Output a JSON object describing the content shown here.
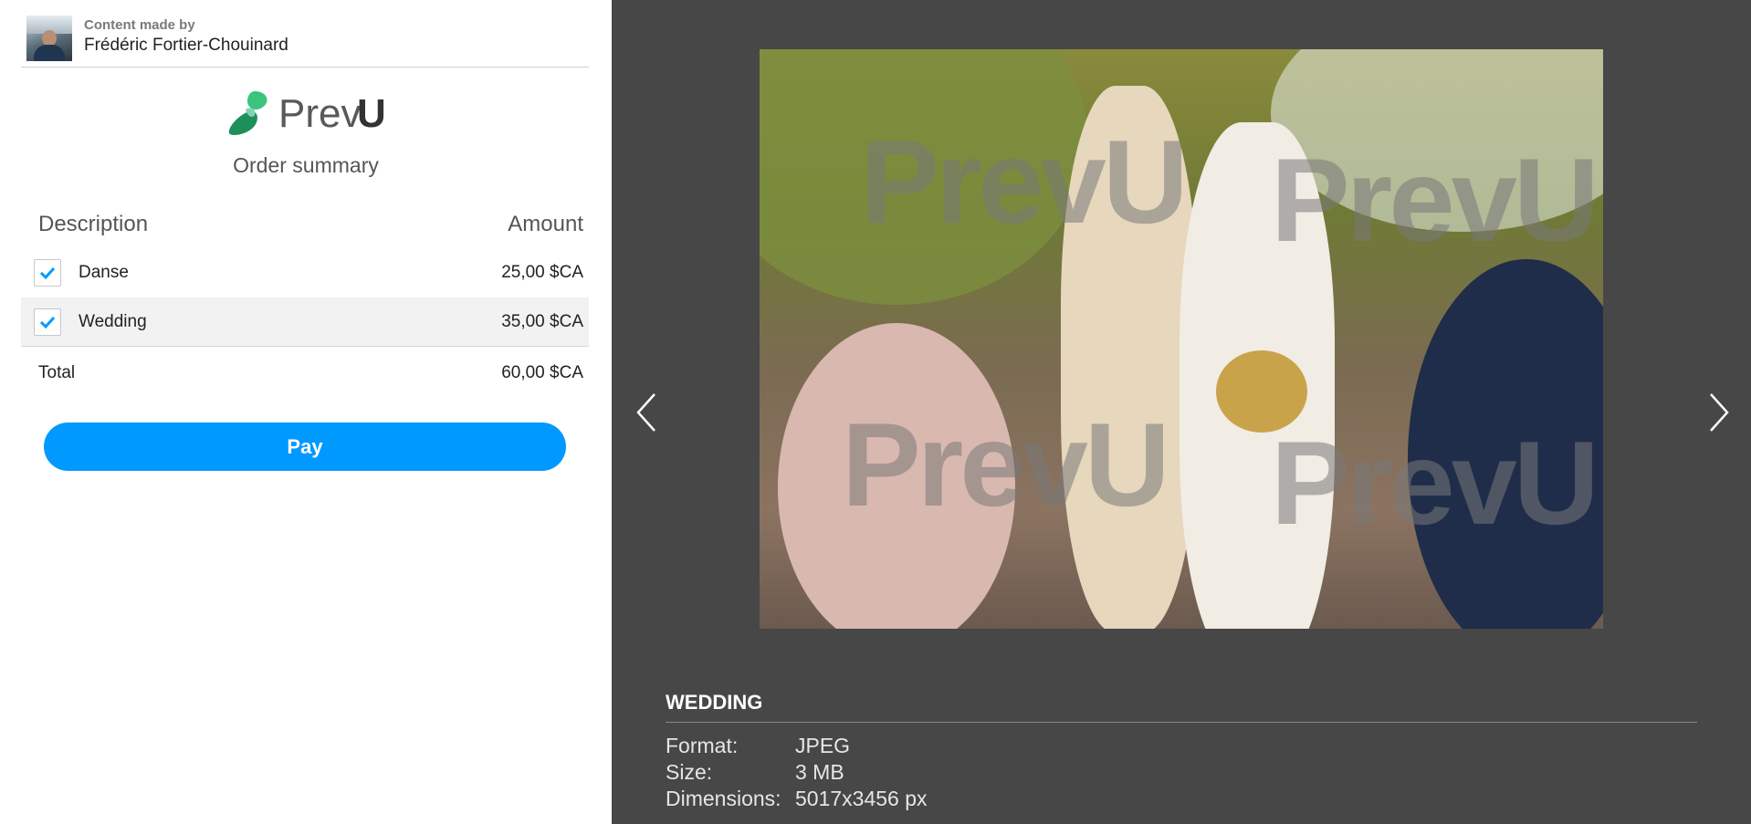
{
  "creator": {
    "made_by_label": "Content made by",
    "name": "Frédéric Fortier-Chouinard"
  },
  "logo": {
    "prev": "Prev",
    "u": "U"
  },
  "order": {
    "title": "Order summary",
    "columns": {
      "description": "Description",
      "amount": "Amount"
    },
    "items": [
      {
        "label": "Danse",
        "amount": "25,00 $CA",
        "checked": true
      },
      {
        "label": "Wedding",
        "amount": "35,00 $CA",
        "checked": true
      }
    ],
    "total": {
      "label": "Total",
      "amount": "60,00 $CA"
    },
    "pay_label": "Pay"
  },
  "viewer": {
    "watermark": "PrevU",
    "title": "WEDDING",
    "meta": [
      {
        "key": "Format:",
        "value": "JPEG"
      },
      {
        "key": "Size:",
        "value": "3 MB"
      },
      {
        "key": "Dimensions:",
        "value": "5017x3456 px"
      }
    ]
  },
  "colors": {
    "accent": "#0099ff",
    "viewer_bg": "#474747",
    "logo_green": "#2bb673"
  }
}
